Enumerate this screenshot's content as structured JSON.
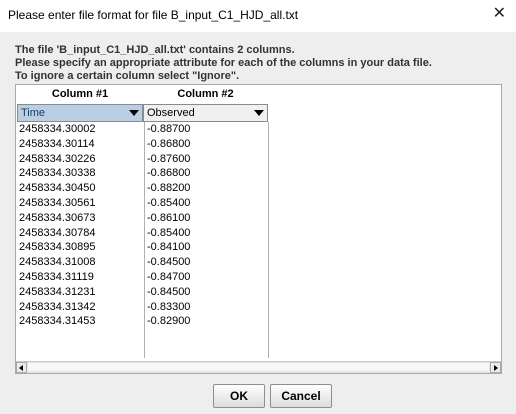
{
  "window": {
    "title": "Please enter file format for file B_input_C1_HJD_all.txt",
    "close_icon": "close-icon"
  },
  "message": {
    "line1": "The file 'B_input_C1_HJD_all.txt' contains 2 columns.",
    "line2": "Please specify an appropriate attribute for each of the columns in your data file.",
    "line3": "To ignore a certain column select \"Ignore\"."
  },
  "table": {
    "columns": [
      {
        "header": "Column #1",
        "selected": "Time"
      },
      {
        "header": "Column #2",
        "selected": "Observed"
      }
    ],
    "time_values": [
      "2458334.30002",
      "2458334.30114",
      "2458334.30226",
      "2458334.30338",
      "2458334.30450",
      "2458334.30561",
      "2458334.30673",
      "2458334.30784",
      "2458334.30895",
      "2458334.31008",
      "2458334.31119",
      "2458334.31231",
      "2458334.31342",
      "2458334.31453"
    ],
    "observed_values": [
      "-0.88700",
      "-0.86800",
      "-0.87600",
      "-0.86800",
      "-0.88200",
      "-0.85400",
      "-0.86100",
      "-0.85400",
      "-0.84100",
      "-0.84500",
      "-0.84700",
      "-0.84500",
      "-0.83300",
      "-0.82900"
    ]
  },
  "buttons": {
    "ok_label": "OK",
    "cancel_label": "Cancel"
  }
}
